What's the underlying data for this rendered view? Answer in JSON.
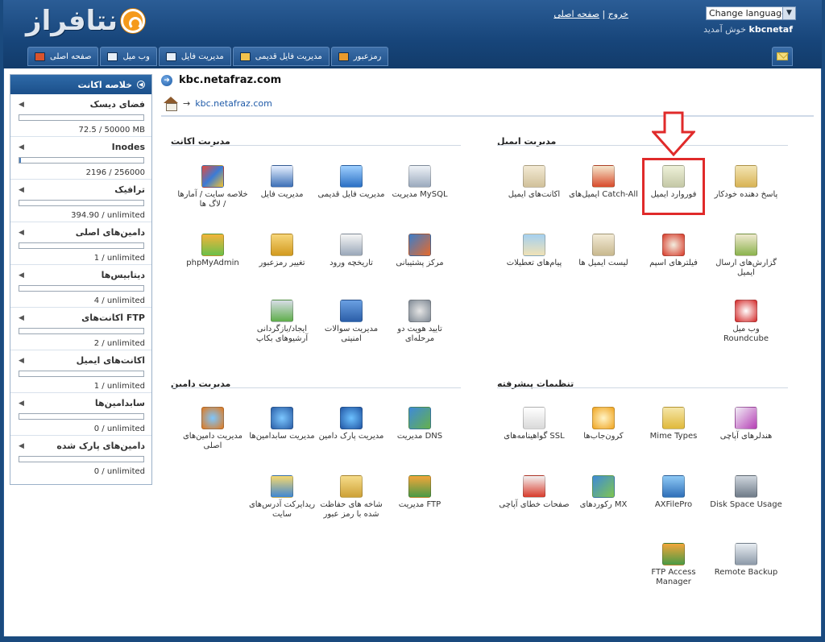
{
  "header": {
    "logo_text": "نتافراز",
    "links": {
      "home": "صفحه اصلی",
      "sep": "|",
      "logout": "خروج"
    },
    "language": "Change language...",
    "welcome_user": "kbcnetaf",
    "welcome_text": "خوش آمدید"
  },
  "navbar": [
    {
      "label": "صفحه اصلی",
      "icon": "home-icon",
      "color": "#d9532c"
    },
    {
      "label": "وب میل",
      "icon": "envelope-icon",
      "color": "#e6eef7"
    },
    {
      "label": "مدیریت فایل",
      "icon": "file-manager-icon",
      "color": "#e6eef7"
    },
    {
      "label": "مدیریت فایل قدیمی",
      "icon": "folder-icon",
      "color": "#f1c24d"
    },
    {
      "label": "رمزعبور",
      "icon": "key-icon",
      "color": "#e99a2c"
    }
  ],
  "stats": {
    "title": "خلاصه اکانت",
    "items": [
      {
        "name": "فضای دیسک",
        "value": "72.5 / 50000 MB",
        "fill_pct": 0
      },
      {
        "name": "Inodes",
        "value": "2196 / 256000",
        "fill_pct": 1
      },
      {
        "name": "ترافیک",
        "value": "394.90 / unlimited",
        "fill_pct": 0
      },
      {
        "name": "دامین‌های اصلی",
        "value": "1 / unlimited",
        "fill_pct": 0
      },
      {
        "name": "دیتابیس‌ها",
        "value": "4 / unlimited",
        "fill_pct": 0
      },
      {
        "name": "اکانت‌های FTP",
        "value": "2 / unlimited",
        "fill_pct": 0
      },
      {
        "name": "اکانت‌های ایمیل",
        "value": "1 / unlimited",
        "fill_pct": 0
      },
      {
        "name": "سابدامین‌ها",
        "value": "0 / unlimited",
        "fill_pct": 0
      },
      {
        "name": "دامین‌های پارک شده",
        "value": "0 / unlimited",
        "fill_pct": 0
      }
    ]
  },
  "main": {
    "domain": "kbc.netafraz.com",
    "breadcrumb": "kbc.netafraz.com"
  },
  "sections": {
    "account": {
      "title": "مدیریت اکانت",
      "items": [
        {
          "label": "مدیریت MySQL",
          "icon": "database-icon"
        },
        {
          "label": "مدیریت فایل قدیمی",
          "icon": "file-manager-old-icon"
        },
        {
          "label": "مدیریت فایل",
          "icon": "file-manager-icon"
        },
        {
          "label": "خلاصه سایت / آمارها / لاگ ها",
          "icon": "stats-icon"
        },
        {
          "label": "مرکز پشتیبانی",
          "icon": "support-icon"
        },
        {
          "label": "تاریخچه ورود",
          "icon": "login-history-icon"
        },
        {
          "label": "تغییر رمزعبور",
          "icon": "lock-icon"
        },
        {
          "label": "phpMyAdmin",
          "icon": "phpmyadmin-icon"
        },
        {
          "label": "تایید هویت دو مرحله‌ای",
          "icon": "two-factor-icon"
        },
        {
          "label": "مدیریت سوالات امنیتی",
          "icon": "security-question-icon"
        },
        {
          "label": "ایجاد/بازگردانی آرشیوهای بکاپ",
          "icon": "backup-icon"
        }
      ]
    },
    "email": {
      "title": "مدیریت ایمیل",
      "items": [
        {
          "label": "پاسخ دهنده خودکار",
          "icon": "autoresponder-icon"
        },
        {
          "label": "فوروارد ایمیل",
          "icon": "forward-icon"
        },
        {
          "label": "ایمیل‌های Catch-All",
          "icon": "catch-all-icon"
        },
        {
          "label": "اکانت‌های ایمیل",
          "icon": "email-accounts-icon"
        },
        {
          "label": "گزارش‌های ارسال ایمیل",
          "icon": "delivery-report-icon"
        },
        {
          "label": "فیلترهای اسپم",
          "icon": "spam-filter-icon"
        },
        {
          "label": "لیست ایمیل ها",
          "icon": "mailing-list-icon"
        },
        {
          "label": "پیام‌های تعطیلات",
          "icon": "vacation-icon"
        },
        {
          "label": "وب میل Roundcube",
          "icon": "roundcube-icon"
        }
      ]
    },
    "domain": {
      "title": "مدیریت دامین",
      "items": [
        {
          "label": "مدیریت DNS",
          "icon": "dns-icon"
        },
        {
          "label": "مدیریت پارک دامین",
          "icon": "park-domain-icon"
        },
        {
          "label": "مدیریت سابدامین‌ها",
          "icon": "subdomain-icon"
        },
        {
          "label": "مدیریت دامین‌های اصلی",
          "icon": "domain-icon"
        },
        {
          "label": "مدیریت FTP",
          "icon": "ftp-icon"
        },
        {
          "label": "شاخه های حفاظت شده با رمز عبور",
          "icon": "protected-folder-icon"
        },
        {
          "label": "ریدایرکت آدرس‌های سایت",
          "icon": "redirect-icon"
        }
      ]
    },
    "advanced": {
      "title": "تنظیمات پیشرفته",
      "items": [
        {
          "label": "هندلرهای آپاچی",
          "icon": "apache-handler-icon"
        },
        {
          "label": "Mime Types",
          "icon": "mime-types-icon"
        },
        {
          "label": "کرون‌جاب‌ها",
          "icon": "cron-icon"
        },
        {
          "label": "گواهینامه‌های SSL",
          "icon": "ssl-icon"
        },
        {
          "label": "Disk Space Usage",
          "icon": "disk-usage-icon"
        },
        {
          "label": "AXFilePro",
          "icon": "axfilepro-icon"
        },
        {
          "label": "رکوردهای MX",
          "icon": "mx-icon"
        },
        {
          "label": "صفحات خطای آپاچی",
          "icon": "error-pages-icon"
        },
        {
          "label": "Remote Backup",
          "icon": "remote-backup-icon"
        },
        {
          "label": "FTP Access Manager",
          "icon": "ftp-access-icon"
        }
      ]
    }
  },
  "colors": {
    "header": "#1a4a7e",
    "accent": "#2e6aa8",
    "highlight": "#e02a2a"
  }
}
